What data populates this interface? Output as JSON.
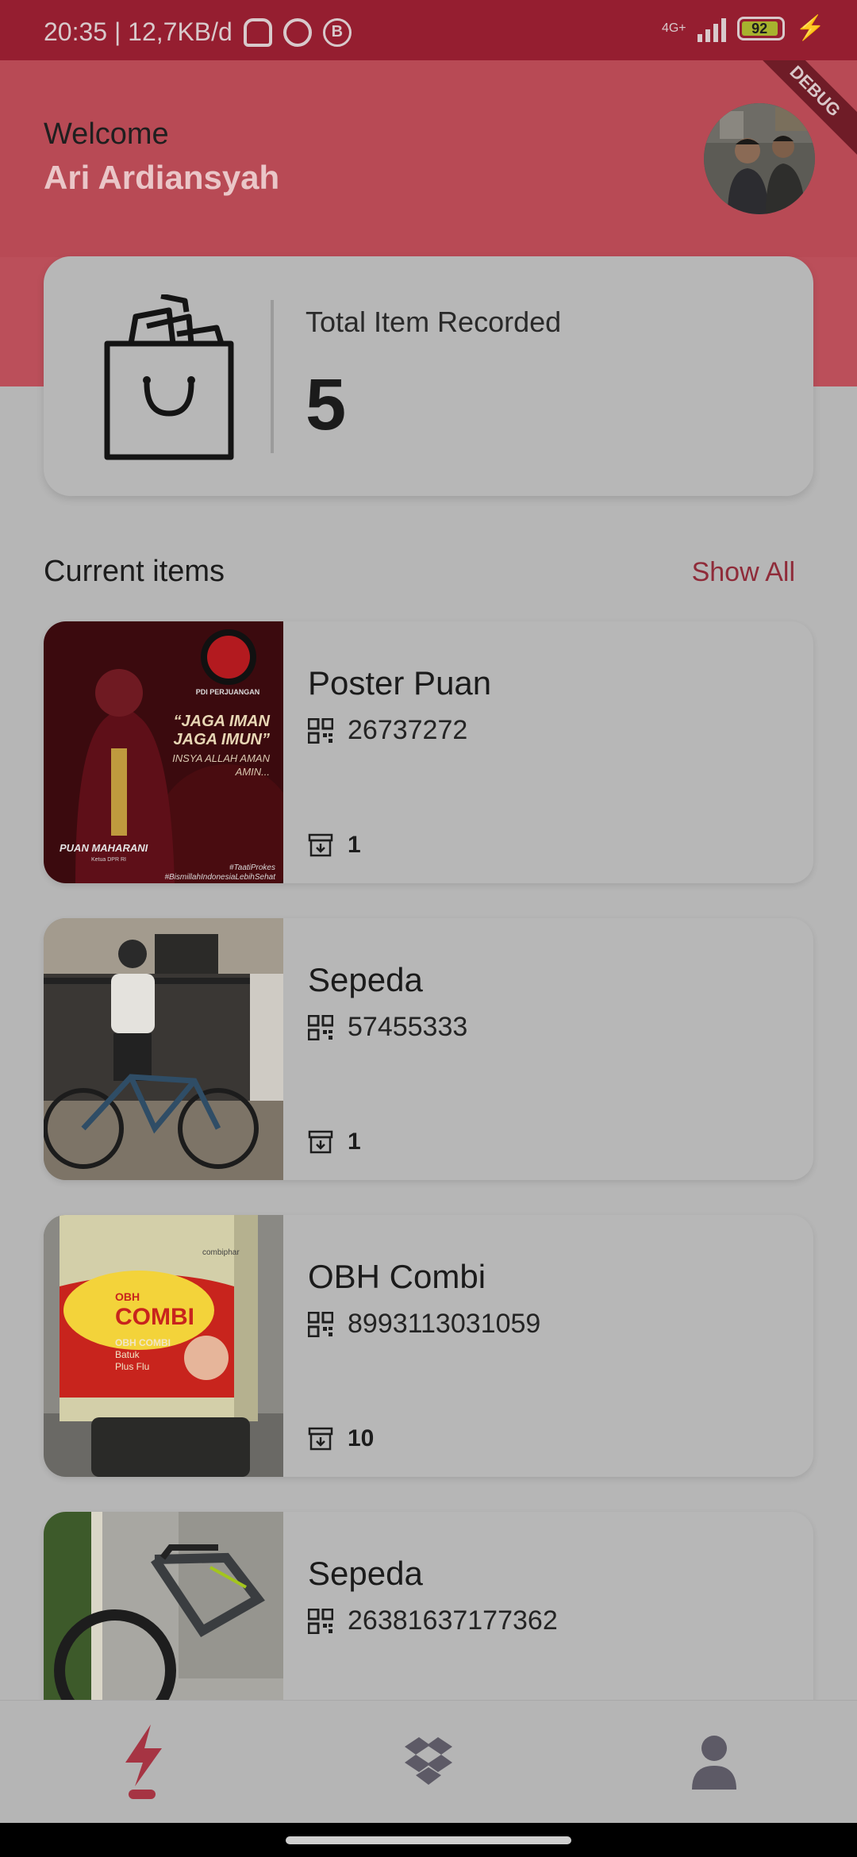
{
  "status_bar": {
    "time_speed": "20:35 | 12,7KB/d",
    "network": "4G+",
    "battery": "92"
  },
  "header": {
    "welcome": "Welcome",
    "user_name": "Ari Ardiansyah",
    "debug_banner": "DEBUG"
  },
  "summary": {
    "label": "Total Item Recorded",
    "count": "5",
    "icon": "shopping-bag-icon"
  },
  "section": {
    "title": "Current items",
    "show_all": "Show All"
  },
  "items": [
    {
      "name": "Poster Puan",
      "code": "26737272",
      "qty": "1",
      "thumb_text": {
        "quote1": "“JAGA IMAN",
        "quote2": "JAGA IMUN”",
        "sub1": "INSYA ALLAH AMAN",
        "sub2": "AMIN...",
        "person": "PUAN MAHARANI",
        "role": "Ketua DPR RI",
        "tag1": "#TaatiProkes",
        "tag2": "#BismillahIndonesiaLebihSehat",
        "logo": "PDI PERJUANGAN"
      }
    },
    {
      "name": "Sepeda",
      "code": "57455333",
      "qty": "1"
    },
    {
      "name": "OBH Combi",
      "code": "8993113031059",
      "qty": "10",
      "thumb_text": {
        "brand": "combiphar",
        "obh": "OBH",
        "combi": "COMBI",
        "line1": "OBH COMBI",
        "line2": "Batuk",
        "line3": "Plus Flu"
      }
    },
    {
      "name": "Sepeda",
      "code": "26381637177362",
      "qty": ""
    }
  ],
  "nav": {
    "items": [
      "flash-icon",
      "dropbox-icon",
      "person-icon"
    ],
    "active": "flash-icon"
  },
  "colors": {
    "header": "#b84a55",
    "accent": "#8f2b39",
    "status_bar": "#951e30",
    "card": "#b7b7b7"
  }
}
